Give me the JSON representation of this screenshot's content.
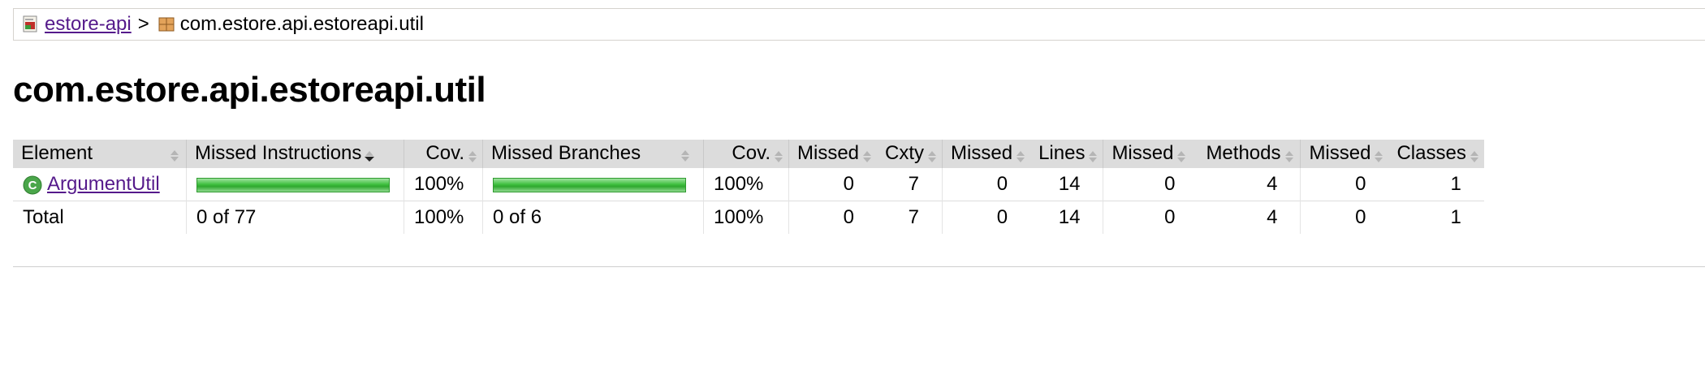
{
  "breadcrumb": {
    "root_label": "estore-api",
    "separator": ">",
    "current_label": "com.estore.api.estoreapi.util"
  },
  "page_title": "com.estore.api.estoreapi.util",
  "table": {
    "headers": {
      "element": "Element",
      "missed_instructions": "Missed Instructions",
      "cov1": "Cov.",
      "missed_branches": "Missed Branches",
      "cov2": "Cov.",
      "missed_cxty": "Missed",
      "cxty": "Cxty",
      "missed_lines": "Missed",
      "lines": "Lines",
      "missed_methods": "Missed",
      "methods": "Methods",
      "missed_classes": "Missed",
      "classes": "Classes"
    },
    "rows": [
      {
        "element": "ArgumentUtil",
        "instructions_covered_fraction": 1.0,
        "cov1": "100%",
        "branches_covered_fraction": 1.0,
        "cov2": "100%",
        "missed_cxty": "0",
        "cxty": "7",
        "missed_lines": "0",
        "lines": "14",
        "missed_methods": "0",
        "methods": "4",
        "missed_classes": "0",
        "classes": "1"
      }
    ],
    "total": {
      "label": "Total",
      "instructions": "0 of 77",
      "cov1": "100%",
      "branches": "0 of 6",
      "cov2": "100%",
      "missed_cxty": "0",
      "cxty": "7",
      "missed_lines": "0",
      "lines": "14",
      "missed_methods": "0",
      "methods": "4",
      "missed_classes": "0",
      "classes": "1"
    }
  },
  "icons": {
    "report": "report-icon",
    "package": "package-icon",
    "class": "class-icon",
    "sort_both": "sort-icon",
    "sort_down": "sort-down-icon"
  },
  "colors": {
    "link": "#551a8b",
    "bar_green": "#3ebf3e",
    "header_bg": "#dcdcdc"
  }
}
